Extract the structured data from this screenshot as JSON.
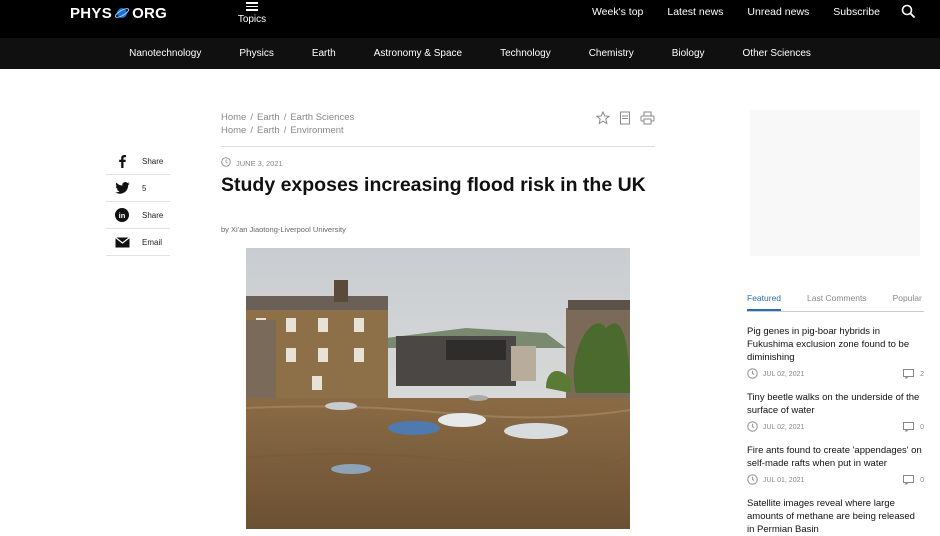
{
  "header": {
    "logo_left": "PHYS",
    "logo_right": "ORG",
    "topics_label": "Topics",
    "nav": [
      "Week's top",
      "Latest news",
      "Unread news",
      "Subscribe"
    ]
  },
  "categories": [
    "Nanotechnology",
    "Physics",
    "Earth",
    "Astronomy & Space",
    "Technology",
    "Chemistry",
    "Biology",
    "Other Sciences"
  ],
  "share": {
    "facebook": "Share",
    "twitter": "5",
    "linkedin": "Share",
    "email": "Email"
  },
  "breadcrumbs": [
    [
      "Home",
      "Earth",
      "Earth Sciences"
    ],
    [
      "Home",
      "Earth",
      "Environment"
    ]
  ],
  "article": {
    "date": "JUNE 3, 2021",
    "title": "Study exposes increasing flood risk in the UK",
    "byline": "by Xi'an Jiaotong-Liverpool University"
  },
  "sidebar": {
    "tabs": [
      "Featured",
      "Last Comments",
      "Popular"
    ],
    "items": [
      {
        "headline": "Pig genes in pig-boar hybrids in Fukushima exclusion zone found to be diminishing",
        "date": "JUL 02, 2021",
        "comments": "2"
      },
      {
        "headline": "Tiny beetle walks on the underside of the surface of water",
        "date": "JUL 02, 2021",
        "comments": "0"
      },
      {
        "headline": "Fire ants found to create 'appendages' on self-made rafts when put in water",
        "date": "JUL 01, 2021",
        "comments": "0"
      },
      {
        "headline": "Satellite images reveal where large amounts of methane are being released in Permian Basin",
        "date": "",
        "comments": ""
      }
    ]
  },
  "colors": {
    "accent": "#2a6fb0",
    "topbar": "#000000",
    "catbar": "#101010"
  }
}
